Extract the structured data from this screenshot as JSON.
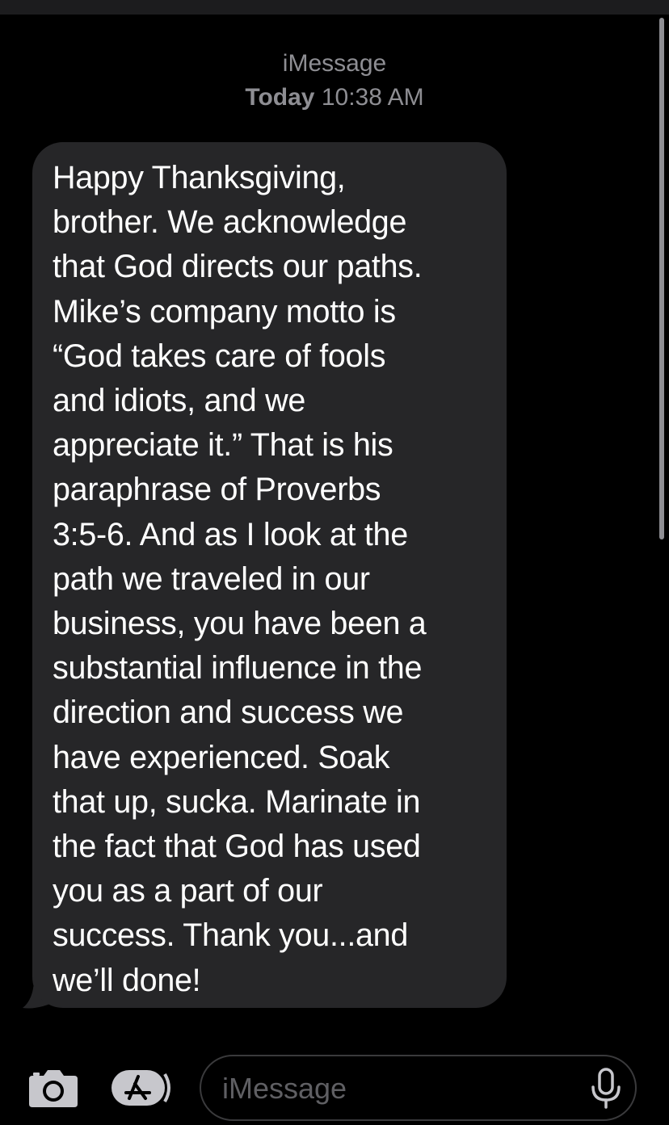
{
  "header": {
    "service": "iMessage",
    "day": "Today",
    "time": "10:38 AM"
  },
  "message": {
    "direction": "incoming",
    "text": "Happy Thanksgiving,\nbrother. We acknowledge\nthat God directs our paths.\nMike’s company motto is\n“God takes care of fools\nand idiots, and we\nappreciate it.”  That is his\nparaphrase of Proverbs\n3:5-6. And as I look at the\npath we traveled in our\nbusiness, you have been a\nsubstantial influence in the\ndirection and success we\nhave experienced. Soak\nthat up, sucka. Marinate in\nthe fact that God has used\nyou as a part of our\nsuccess. Thank you...and\nwe’ll done!"
  },
  "composer": {
    "placeholder": "iMessage",
    "icons": {
      "camera": "camera-icon",
      "apps": "app-store-icon",
      "mic": "microphone-icon"
    }
  },
  "colors": {
    "background": "#000000",
    "incoming_bubble": "#262628",
    "header_text": "#8e8e93",
    "placeholder_text": "#5f5f63",
    "icon_gray": "#c7c7cc"
  }
}
